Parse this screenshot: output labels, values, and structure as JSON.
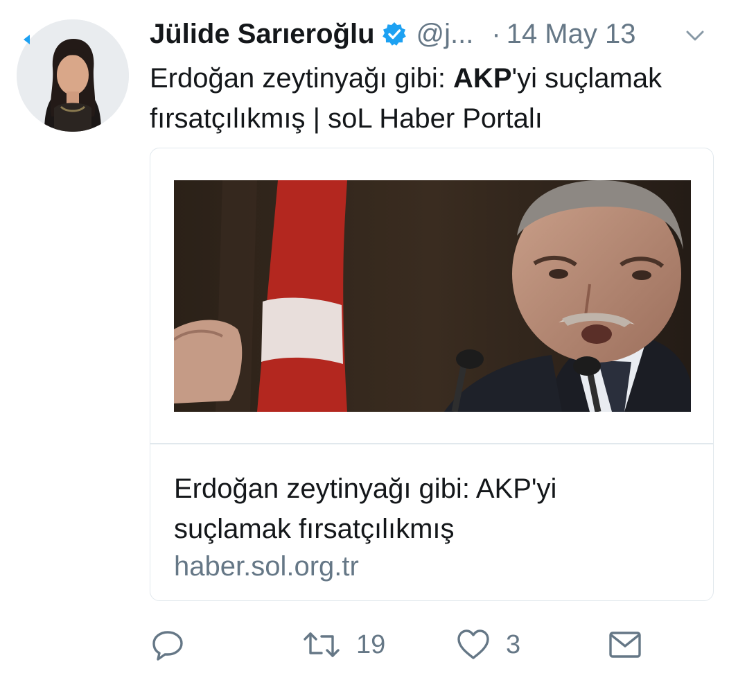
{
  "user": {
    "display_name": "Jülide Sarıeroğlu",
    "handle": "@j...",
    "separator": "·",
    "date": "14 May 13",
    "verified": true,
    "avatar_icon": "profile-photo"
  },
  "tweet": {
    "text_before": "Erdoğan zeytinyağı gibi: ",
    "text_bold": "AKP",
    "text_after": "'yi suçlamak fırsatçılıkmış | soL Haber Portalı"
  },
  "card": {
    "image_icon": "news-photo",
    "title": "Erdoğan zeytinyağı gibi: AKP'yi suçlamak fırsatçılıkmış",
    "domain": "haber.sol.org.tr"
  },
  "actions": {
    "reply": {
      "icon": "reply-icon",
      "count": ""
    },
    "retweet": {
      "icon": "retweet-icon",
      "count": "19"
    },
    "like": {
      "icon": "heart-icon",
      "count": "3"
    },
    "message": {
      "icon": "envelope-icon",
      "count": ""
    }
  },
  "colors": {
    "text": "#14171a",
    "secondary": "#657786",
    "accent": "#1da1f2",
    "border": "#e1e8ed"
  }
}
